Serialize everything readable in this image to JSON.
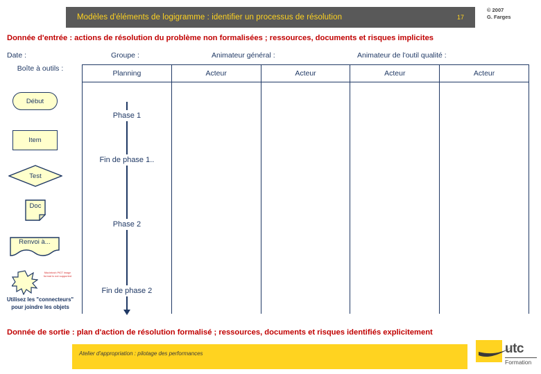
{
  "header": {
    "title": "Modèles d'éléments de logigramme : identifier un processus de résolution",
    "slide_number": "17",
    "copyright_line1": "© 2007",
    "copyright_line2": "G. Farges",
    "bar_color": "#595959",
    "title_color": "#ffd320"
  },
  "banners": {
    "input": "Donnée d'entrée : actions de résolution du problème non formalisées ; ressources, documents et risques implicites",
    "output": "Donnée de sortie : plan d'action de résolution formalisé ; ressources, documents et risques identifiés explicitement",
    "color": "#c00000"
  },
  "fields": {
    "date": "Date :",
    "group": "Groupe :",
    "animator_general": "Animateur général :",
    "animator_quality": "Animateur de l'outil qualité :"
  },
  "toolbox": {
    "title": "Boîte à outils :",
    "shapes": [
      {
        "label": "Début",
        "type": "terminator"
      },
      {
        "label": "Item",
        "type": "process"
      },
      {
        "label": "Test",
        "type": "decision"
      },
      {
        "label": "Doc",
        "type": "document"
      },
      {
        "label": "Renvoi à...",
        "type": "punched-tape"
      }
    ],
    "pict_warning": "Macintosh PICT image format is not supported",
    "caption": "Utilisez les \"connecteurs\" pour joindre les objets",
    "shape_fill": "#ffffcc",
    "shape_stroke": "#1f3864"
  },
  "lanes": {
    "headers": [
      "Planning",
      "Acteur",
      "Acteur",
      "Acteur",
      "Acteur"
    ],
    "timeline_markers": [
      "Phase 1",
      "Fin de phase 1..",
      "Phase 2",
      "Fin de phase 2"
    ]
  },
  "footer": {
    "text": "Atelier d'appropriation : pilotage des performances",
    "bar_color": "#ffd320",
    "logo_name": "utc",
    "logo_sub": "Formation"
  }
}
